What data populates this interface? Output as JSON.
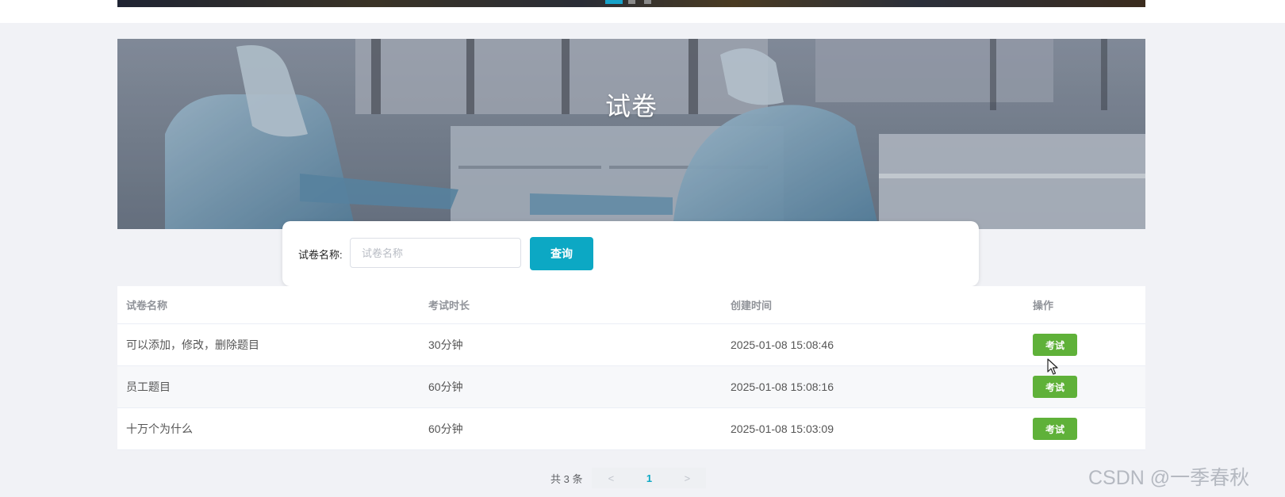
{
  "banner": {
    "title": "试卷"
  },
  "search": {
    "label": "试卷名称:",
    "placeholder": "试卷名称",
    "button_label": "查询"
  },
  "table": {
    "columns": [
      "试卷名称",
      "考试时长",
      "创建时间",
      "操作"
    ],
    "rows": [
      {
        "name": "可以添加，修改，删除题目",
        "duration": "30分钟",
        "created": "2025-01-08 15:08:46",
        "action": "考试"
      },
      {
        "name": "员工题目",
        "duration": "60分钟",
        "created": "2025-01-08 15:08:16",
        "action": "考试"
      },
      {
        "name": "十万个为什么",
        "duration": "60分钟",
        "created": "2025-01-08 15:03:09",
        "action": "考试"
      }
    ]
  },
  "pagination": {
    "total_text": "共 3 条",
    "prev": "<",
    "next": ">",
    "current_page": "1"
  },
  "watermark": "CSDN @一季春秋",
  "colors": {
    "primary": "#0ca8c4",
    "exam_button": "#5fb139",
    "page_bg": "#f1f2f6"
  },
  "icons": {
    "cursor": "mouse-pointer-icon",
    "prev": "chevron-left-icon",
    "next": "chevron-right-icon"
  }
}
